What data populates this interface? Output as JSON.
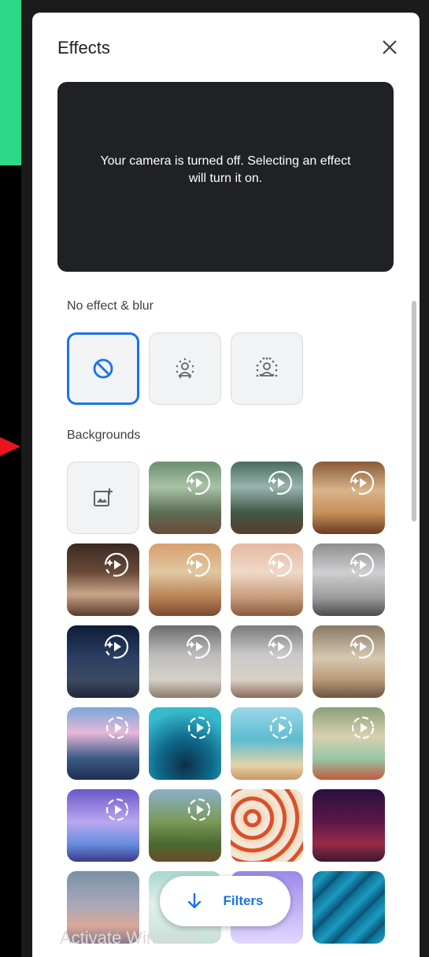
{
  "panel": {
    "title": "Effects",
    "preview_message": "Your camera is turned off. Selecting an effect will turn it on."
  },
  "sections": {
    "no_effect_label": "No effect & blur",
    "backgrounds_label": "Backgrounds"
  },
  "no_effect_tiles": [
    {
      "name": "no-effect",
      "icon": "no-effect-icon",
      "selected": true
    },
    {
      "name": "slight-blur",
      "icon": "slight-blur-icon",
      "selected": false
    },
    {
      "name": "blur",
      "icon": "blur-icon",
      "selected": false
    }
  ],
  "backgrounds": [
    {
      "name": "upload-background",
      "icon": "add-image-icon"
    },
    {
      "name": "greenhouse",
      "icon": "sparkle-play-icon"
    },
    {
      "name": "greenhouse-dusk",
      "icon": "sparkle-play-icon"
    },
    {
      "name": "cozy-lounge",
      "icon": "sparkle-play-icon"
    },
    {
      "name": "cabin-living-room",
      "icon": "sparkle-play-icon"
    },
    {
      "name": "japanese-room",
      "icon": "sparkle-play-icon"
    },
    {
      "name": "japanese-room-2",
      "icon": "sparkle-play-icon"
    },
    {
      "name": "city-loft",
      "icon": "sparkle-play-icon"
    },
    {
      "name": "night-apartment",
      "icon": "sparkle-play-icon"
    },
    {
      "name": "kitchen",
      "icon": "sparkle-play-icon"
    },
    {
      "name": "kitchen-2",
      "icon": "sparkle-play-icon"
    },
    {
      "name": "shelf-room",
      "icon": "sparkle-play-icon"
    },
    {
      "name": "car-interior",
      "icon": "play-icon"
    },
    {
      "name": "underwater",
      "icon": "play-icon"
    },
    {
      "name": "beach-island",
      "icon": "play-icon"
    },
    {
      "name": "classroom",
      "icon": "play-icon"
    },
    {
      "name": "purple-room",
      "icon": "play-icon"
    },
    {
      "name": "forest",
      "icon": "play-icon"
    },
    {
      "name": "red-pattern",
      "icon": "none"
    },
    {
      "name": "theater",
      "icon": "none"
    },
    {
      "name": "sunset-gradient",
      "icon": "none"
    },
    {
      "name": "mint-gradient",
      "icon": "none"
    },
    {
      "name": "lilac-gradient",
      "icon": "none"
    },
    {
      "name": "water-texture",
      "icon": "none"
    }
  ],
  "filters_button": {
    "label": "Filters",
    "icon": "arrow-down-icon"
  },
  "watermark": "Activate Windows",
  "colors": {
    "accent": "#1a73e8",
    "preview_bg": "#202124",
    "page_green": "#2ed888",
    "arrow_red": "#e8161c"
  }
}
